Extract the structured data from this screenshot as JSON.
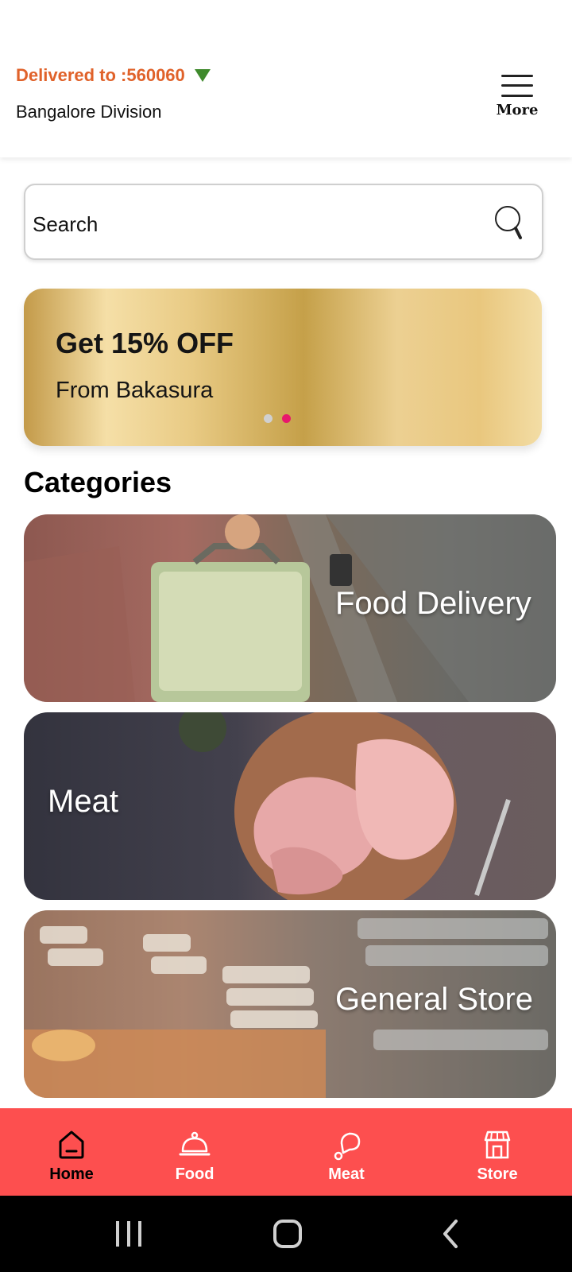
{
  "header": {
    "delivered_label": "Delivered to :560060",
    "division": "Bangalore Division",
    "more_label": "More"
  },
  "search": {
    "placeholder": "Search"
  },
  "promo": {
    "title": "Get 15% OFF",
    "subtitle": "From Bakasura",
    "carousel": {
      "count": 2,
      "active_index": 1
    }
  },
  "categories": {
    "title": "Categories",
    "items": [
      {
        "label": "Food Delivery"
      },
      {
        "label": "Meat"
      },
      {
        "label": "General Store"
      }
    ]
  },
  "bottom_nav": {
    "items": [
      {
        "label": "Home",
        "icon": "home-icon",
        "active": true
      },
      {
        "label": "Food",
        "icon": "cloche-icon",
        "active": false
      },
      {
        "label": "Meat",
        "icon": "drumstick-icon",
        "active": false
      },
      {
        "label": "Store",
        "icon": "store-icon",
        "active": false
      }
    ]
  },
  "colors": {
    "accent_orange": "#e0622a",
    "location_arrow": "#3f8a2c",
    "nav_background": "#fd4f4f",
    "dot_active": "#e8186c",
    "dot_inactive": "#d0d0d0"
  }
}
